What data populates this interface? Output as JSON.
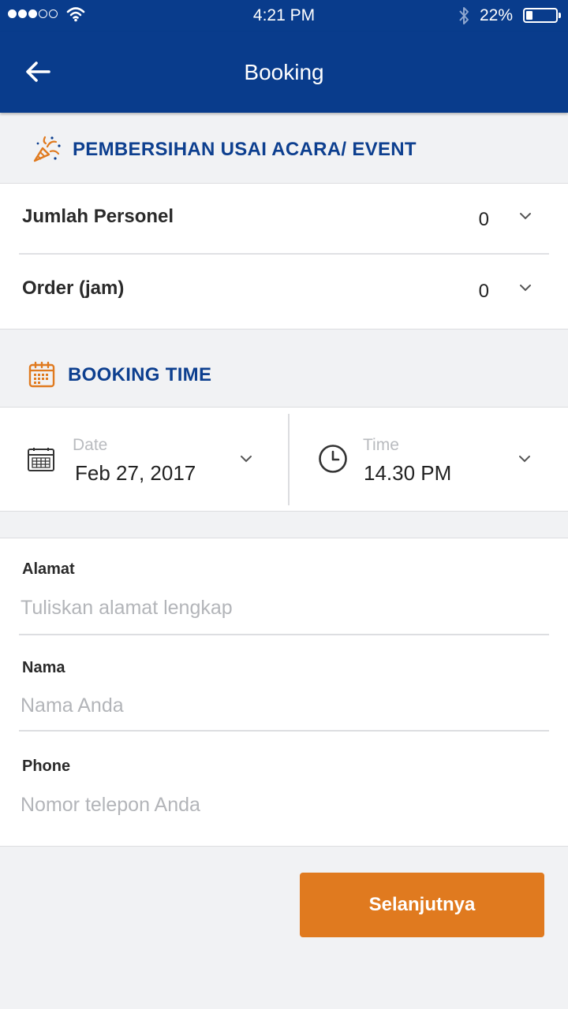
{
  "status_bar": {
    "time": "4:21 PM",
    "battery_percent_text": "22%",
    "battery_level": 0.22,
    "signal_dots_filled": 3,
    "signal_dots_total": 5
  },
  "header": {
    "title": "Booking",
    "background_color": "#093c8c"
  },
  "service": {
    "icon": "party-popper-icon",
    "title": "PEMBERSIHAN USAI ACARA/ EVENT"
  },
  "options": [
    {
      "label": "Jumlah Personel",
      "value": "0"
    },
    {
      "label": "Order (jam)",
      "value": "0"
    }
  ],
  "booking_time": {
    "icon": "calendar-icon",
    "title": "BOOKING TIME",
    "date_label": "Date",
    "date_value": "Feb 27, 2017",
    "time_label": "Time",
    "time_value": "14.30 PM"
  },
  "form": {
    "address": {
      "label": "Alamat",
      "placeholder": "Tuliskan alamat lengkap",
      "value": ""
    },
    "name": {
      "label": "Nama",
      "placeholder": "Nama Anda",
      "value": ""
    },
    "phone": {
      "label": "Phone",
      "placeholder": "Nomor telepon Anda",
      "value": ""
    }
  },
  "next_button": {
    "label": "Selanjutnya",
    "color": "#e07a1f"
  },
  "colors": {
    "accent_blue": "#0d3f8f",
    "accent_orange": "#e07a1f"
  }
}
